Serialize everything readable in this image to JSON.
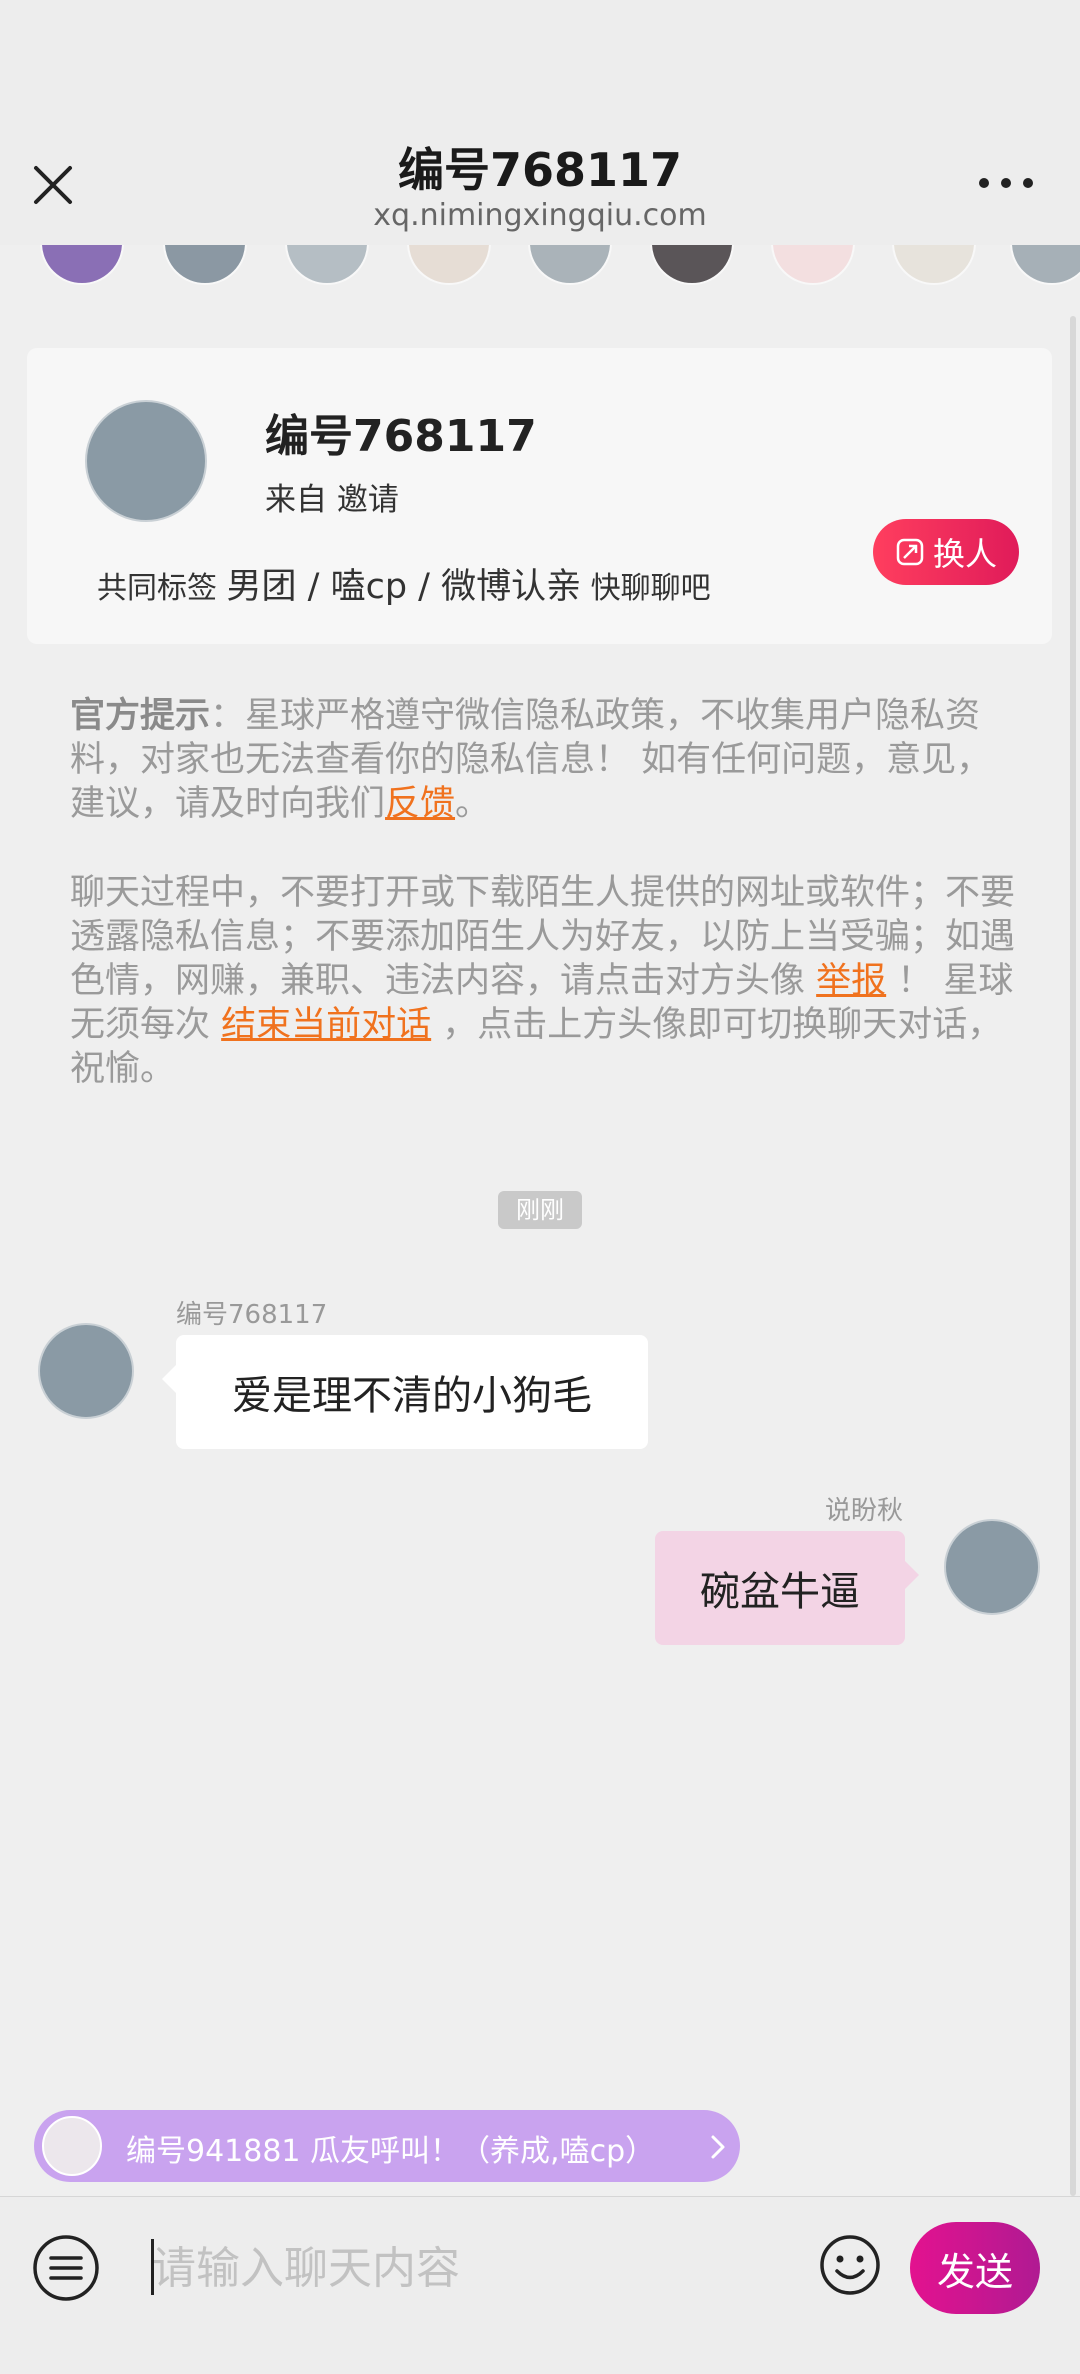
{
  "header": {
    "title": "编号768117",
    "url": "xq.nimingxingqiu.com"
  },
  "avatar_strip": {
    "colors": [
      "#8a6fb5",
      "#8b98a3",
      "#b5bec4",
      "#e6ddd5",
      "#aab3b9",
      "#5a5558",
      "#f3dfe0",
      "#e7e3dc",
      "#a6b0b7"
    ]
  },
  "profile": {
    "name": "编号768117",
    "source": "来自 邀请",
    "tags_label": "共同标签",
    "tags": "男团 / 嗑cp / 微博认亲",
    "tags_extra": "快聊聊吧",
    "swap_label": "换人"
  },
  "notice": {
    "bold_label": "官方提示",
    "text1": "：星球严格遵守微信隐私政策，不收集用户隐私资料，对家也无法查看你的隐私信息！ 如有任何问题，意见，建议，请及时向我们",
    "feedback_link": "反馈",
    "text1_end": "。",
    "text2": "聊天过程中，不要打开或下载陌生人提供的网址或软件；不要透露隐私信息；不要添加陌生人为好友，以防上当受骗；如遇色情，网赚，兼职、违法内容，请点击对方头像 ",
    "report_link": "举报",
    "text3": " ！ 星球无须每次 ",
    "end_link": "结束当前对话",
    "text4": " ，点击上方头像即可切换聊天对话，祝愉。"
  },
  "chat": {
    "time": "刚刚",
    "incoming": {
      "name": "编号768117",
      "text": "爱是理不清的小狗毛"
    },
    "outgoing": {
      "name": "说盼秋",
      "text": "碗盆牛逼"
    }
  },
  "call_banner": {
    "text": "编号941881 瓜友呼叫！（养成,嗑cp）"
  },
  "input": {
    "placeholder": "请输入聊天内容",
    "send_label": "发送"
  },
  "colors": {
    "accent_pink": "#e01b5a",
    "send_gradient": "#c2158f",
    "link_orange": "#f0721e"
  }
}
